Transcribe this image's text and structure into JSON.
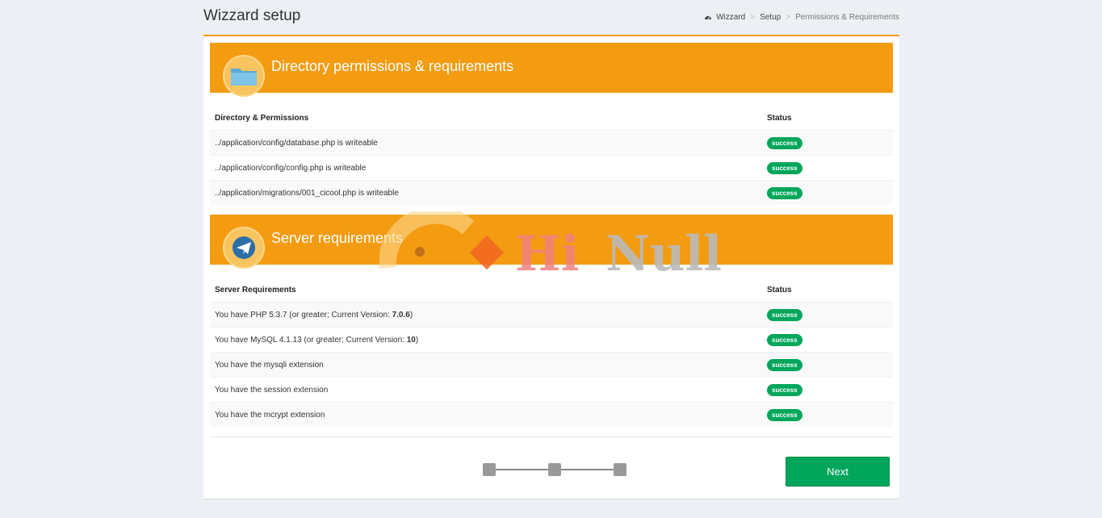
{
  "header": {
    "title": "Wizzard setup",
    "breadcrumb": [
      "Wizzard",
      "Setup",
      "Permissions & Requirements"
    ]
  },
  "section1": {
    "title": "Directory permissions & requirements",
    "icon": "folder-icon",
    "columns": [
      "Directory & Permissions",
      "Status"
    ],
    "rows": [
      {
        "text": "../application/config/database.php is writeable",
        "status": "success"
      },
      {
        "text": "../application/config/config.php is writeable",
        "status": "success"
      },
      {
        "text": "../application/migrations/001_cicool.php is writeable",
        "status": "success"
      }
    ]
  },
  "section2": {
    "title": "Server requirements",
    "icon": "paper-plane-icon",
    "columns": [
      "Server Requirements",
      "Status"
    ],
    "rows": [
      {
        "text_prefix": "You have PHP 5.3.7 (or greater; Current Version: ",
        "bold": "7.0.6",
        "text_suffix": ")",
        "status": "success"
      },
      {
        "text_prefix": "You have MySQL 4.1.13 (or greater; Current Version: ",
        "bold": "10",
        "text_suffix": ")",
        "status": "success"
      },
      {
        "text": "You have the mysqli extension",
        "status": "success"
      },
      {
        "text": "You have the session extension",
        "status": "success"
      },
      {
        "text": "You have the mcrypt extension",
        "status": "success"
      }
    ]
  },
  "wizard": {
    "steps": 3,
    "next_label": "Next"
  },
  "watermark": {
    "text1": "Hi",
    "text2": "Null"
  },
  "colors": {
    "accent": "#f39c12",
    "success": "#00a65a",
    "background": "#ecf0f5"
  }
}
